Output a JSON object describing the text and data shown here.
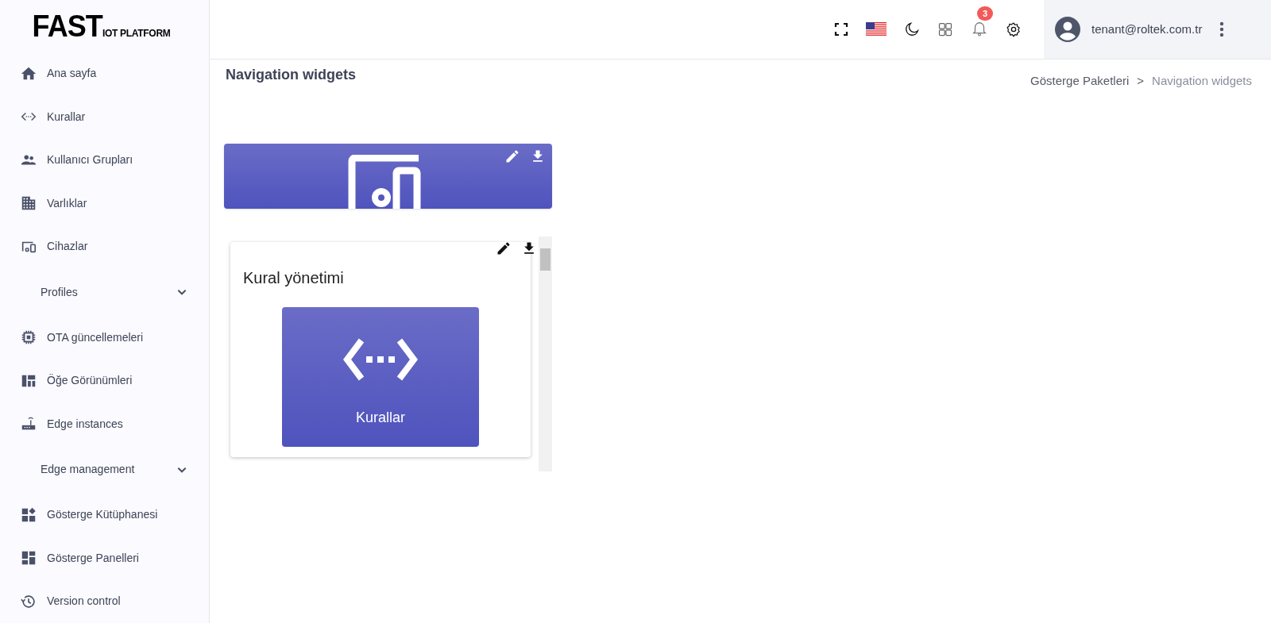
{
  "logo": {
    "brand": "FAST",
    "tagline": "IOT PLATFORM"
  },
  "sidebar": {
    "items": [
      {
        "kind": "link",
        "label": "Ana sayfa"
      },
      {
        "kind": "link",
        "label": "Kurallar"
      },
      {
        "kind": "link",
        "label": "Kullanıcı Grupları"
      },
      {
        "kind": "link",
        "label": "Varlıklar"
      },
      {
        "kind": "link",
        "label": "Cihazlar"
      },
      {
        "kind": "group",
        "label": "Profiles",
        "expanded": false
      },
      {
        "kind": "link",
        "label": "OTA güncellemeleri"
      },
      {
        "kind": "link",
        "label": "Öğe Görünümleri"
      },
      {
        "kind": "link",
        "label": "Edge instances"
      },
      {
        "kind": "group",
        "label": "Edge management",
        "expanded": false
      },
      {
        "kind": "link",
        "label": "Gösterge Kütüphanesi"
      },
      {
        "kind": "link",
        "label": "Gösterge Panelleri"
      },
      {
        "kind": "link",
        "label": "Version control"
      }
    ]
  },
  "header": {
    "notification_count": "3",
    "user": {
      "email": "tenant@roltek.com.tr"
    }
  },
  "page": {
    "title": "Navigation widgets",
    "breadcrumb": [
      {
        "kind": "link",
        "label": "Gösterge Paketleri",
        "selected": false
      },
      {
        "kind": "separator",
        "label": ">"
      },
      {
        "kind": "link",
        "label": "Navigation widgets",
        "selected": true
      }
    ]
  },
  "widgets": [
    {
      "kind": "banner"
    },
    {
      "kind": "nav_card",
      "title": "Kural yönetimi",
      "button_label": "Kurallar"
    }
  ]
}
